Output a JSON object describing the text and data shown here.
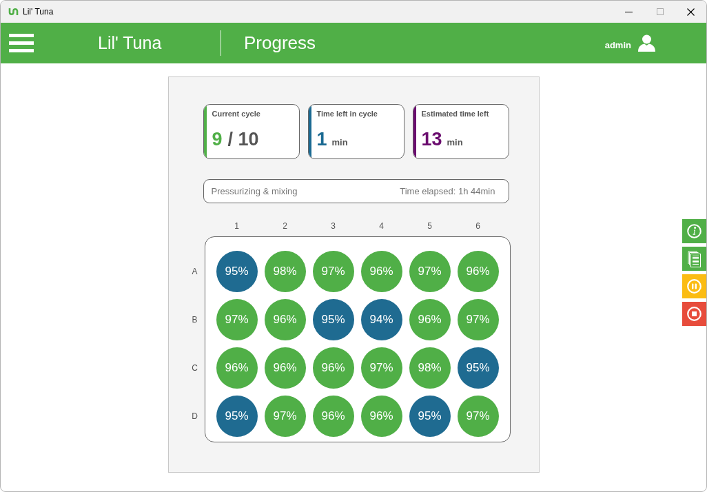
{
  "window": {
    "title": "Lil' Tuna"
  },
  "header": {
    "app_name": "Lil' Tuna",
    "page_title": "Progress",
    "user": "admin"
  },
  "cards": [
    {
      "kind": "fraction",
      "label": "Current cycle",
      "value": "9",
      "unit": "/ 10",
      "color": "#50af47"
    },
    {
      "kind": "duration",
      "label": "Time left in cycle",
      "value": "1",
      "unit": "min",
      "color": "#1b6a92"
    },
    {
      "kind": "duration",
      "label": "Estimated time left",
      "value": "13",
      "unit": "min",
      "color": "#6b0d6f"
    }
  ],
  "status": {
    "phase": "Pressurizing & mixing",
    "elapsed": "Time elapsed: 1h 44min"
  },
  "plate": {
    "columns": [
      "1",
      "2",
      "3",
      "4",
      "5",
      "6"
    ],
    "rows": [
      {
        "label": "A",
        "wells": [
          {
            "value": "95%",
            "color": "#1f6b91"
          },
          {
            "value": "98%",
            "color": "#50af47"
          },
          {
            "value": "97%",
            "color": "#50af47"
          },
          {
            "value": "96%",
            "color": "#50af47"
          },
          {
            "value": "97%",
            "color": "#50af47"
          },
          {
            "value": "96%",
            "color": "#50af47"
          }
        ]
      },
      {
        "label": "B",
        "wells": [
          {
            "value": "97%",
            "color": "#50af47"
          },
          {
            "value": "96%",
            "color": "#50af47"
          },
          {
            "value": "95%",
            "color": "#1f6b91"
          },
          {
            "value": "94%",
            "color": "#1f6b91"
          },
          {
            "value": "96%",
            "color": "#50af47"
          },
          {
            "value": "97%",
            "color": "#50af47"
          }
        ]
      },
      {
        "label": "C",
        "wells": [
          {
            "value": "96%",
            "color": "#50af47"
          },
          {
            "value": "96%",
            "color": "#50af47"
          },
          {
            "value": "96%",
            "color": "#50af47"
          },
          {
            "value": "97%",
            "color": "#50af47"
          },
          {
            "value": "98%",
            "color": "#50af47"
          },
          {
            "value": "95%",
            "color": "#1f6b91"
          }
        ]
      },
      {
        "label": "D",
        "wells": [
          {
            "value": "95%",
            "color": "#1f6b91"
          },
          {
            "value": "97%",
            "color": "#50af47"
          },
          {
            "value": "96%",
            "color": "#50af47"
          },
          {
            "value": "96%",
            "color": "#50af47"
          },
          {
            "value": "95%",
            "color": "#1f6b91"
          },
          {
            "value": "97%",
            "color": "#50af47"
          }
        ]
      }
    ]
  },
  "side_buttons": [
    {
      "kind": "info",
      "color": "#50af47"
    },
    {
      "kind": "document",
      "color": "#50af47"
    },
    {
      "kind": "pause",
      "color": "#fbbc13"
    },
    {
      "kind": "stop",
      "color": "#e74c3c"
    }
  ]
}
